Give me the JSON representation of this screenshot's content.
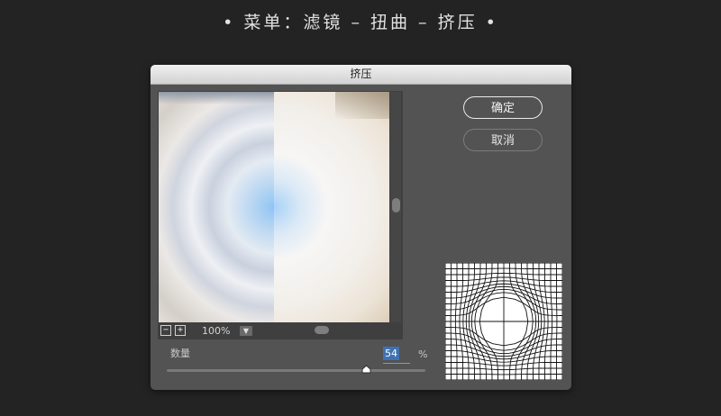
{
  "caption": "• 菜单：滤镜 – 扭曲 – 挤压 •",
  "dialog": {
    "title": "挤压",
    "ok_label": "确定",
    "cancel_label": "取消",
    "zoom": {
      "minus_icon": "zoom-out-icon",
      "plus_icon": "zoom-in-icon",
      "level": "100%",
      "dropdown_icon": "chevron-down-icon"
    },
    "amount": {
      "label": "数量",
      "value": "54",
      "unit": "%",
      "slider_fraction": 0.77
    }
  },
  "colors": {
    "background": "#232323",
    "dialog": "#535353",
    "accent_selection": "#3f72b4"
  }
}
